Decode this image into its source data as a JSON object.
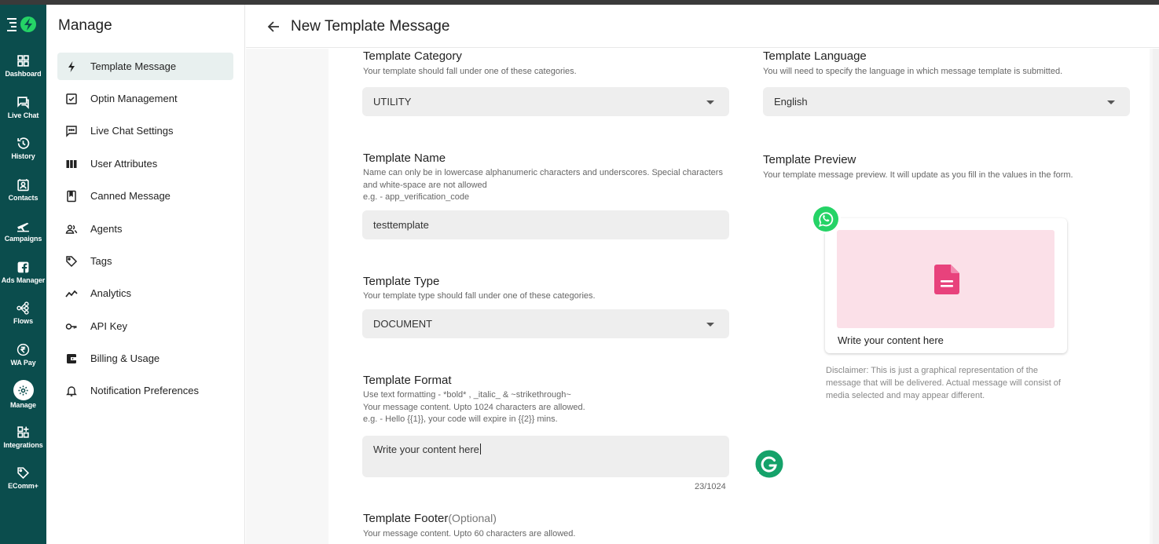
{
  "rail": {
    "items": [
      {
        "label": "Dashboard",
        "icon": "dashboard-icon"
      },
      {
        "label": "Live Chat",
        "icon": "chat-icon"
      },
      {
        "label": "History",
        "icon": "history-icon"
      },
      {
        "label": "Contacts",
        "icon": "contacts-icon"
      },
      {
        "label": "Campaigns",
        "icon": "campaigns-icon"
      },
      {
        "label": "Ads Manager",
        "icon": "facebook-icon"
      },
      {
        "label": "Flows",
        "icon": "flows-icon"
      },
      {
        "label": "WA Pay",
        "icon": "rupee-icon"
      },
      {
        "label": "Manage",
        "icon": "gear-icon"
      },
      {
        "label": "Integrations",
        "icon": "integrations-icon"
      },
      {
        "label": "EComm+",
        "icon": "tag-icon"
      }
    ]
  },
  "manage": {
    "title": "Manage",
    "items": [
      {
        "label": "Template Message",
        "icon": "bolt-icon"
      },
      {
        "label": "Optin Management",
        "icon": "checkbox-icon"
      },
      {
        "label": "Live Chat Settings",
        "icon": "chat-dots-icon"
      },
      {
        "label": "User Attributes",
        "icon": "columns-icon"
      },
      {
        "label": "Canned Message",
        "icon": "bookmark-icon"
      },
      {
        "label": "Agents",
        "icon": "people-icon"
      },
      {
        "label": "Tags",
        "icon": "tag-icon"
      },
      {
        "label": "Analytics",
        "icon": "trend-icon"
      },
      {
        "label": "API Key",
        "icon": "key-icon"
      },
      {
        "label": "Billing & Usage",
        "icon": "wallet-icon"
      },
      {
        "label": "Notification Preferences",
        "icon": "bell-icon"
      }
    ]
  },
  "header": {
    "title": "New Template Message"
  },
  "form": {
    "category": {
      "title": "Template Category",
      "desc": "Your template should fall under one of these categories.",
      "value": "UTILITY"
    },
    "language": {
      "title": "Template Language",
      "desc": "You will need to specify the language in which message template is submitted.",
      "value": "English"
    },
    "name": {
      "title": "Template Name",
      "desc1": "Name can only be in lowercase alphanumeric characters and underscores. Special characters",
      "desc2": "and white-space are not allowed",
      "desc3": "e.g. - app_verification_code",
      "value": "testtemplate"
    },
    "type": {
      "title": "Template Type",
      "desc": "Your template type should fall under one of these categories.",
      "value": "DOCUMENT"
    },
    "format": {
      "title": "Template Format",
      "desc1": "Use text formatting - *bold* , _italic_ & ~strikethrough~",
      "desc2": "Your message content. Upto 1024 characters are allowed.",
      "desc3": "e.g. - Hello {{1}}, your code will expire in {{2}} mins.",
      "value": "Write your content here",
      "counter": "23/1024"
    },
    "footer": {
      "title": "Template Footer",
      "optional": "(Optional)",
      "desc": "Your message content. Upto 60 characters are allowed."
    }
  },
  "preview": {
    "title": "Template Preview",
    "desc": "Your template message preview. It will update as you fill in the values in the form.",
    "text": "Write your content here",
    "disclaimer": "Disclaimer: This is just a graphical representation of the message that will be delivered. Actual message will consist of media selected and may appear different."
  },
  "colors": {
    "rail": "#0b4d4d",
    "accent": "#25d366",
    "media_bg": "#fbe0e8",
    "doc_icon": "#e8427c"
  }
}
